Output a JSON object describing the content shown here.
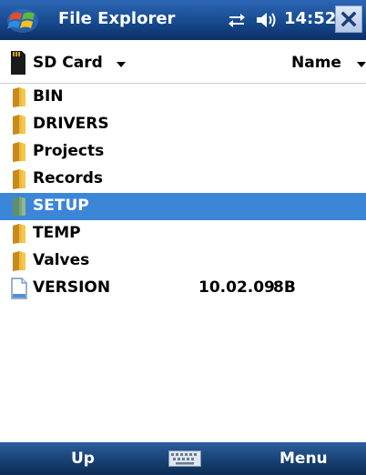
{
  "titlebar": {
    "title": "File Explorer",
    "time": "14:52",
    "start_icon": "windows-flag-icon",
    "connectivity_icon": "connectivity-arrows-icon",
    "volume_icon": "speaker-icon",
    "close_icon": "close-x-icon"
  },
  "header": {
    "location": "SD Card",
    "sort": "Name"
  },
  "files": [
    {
      "name": "BIN",
      "type": "folder",
      "date": "",
      "size": "",
      "selected": false
    },
    {
      "name": "DRIVERS",
      "type": "folder",
      "date": "",
      "size": "",
      "selected": false
    },
    {
      "name": "Projects",
      "type": "folder",
      "date": "",
      "size": "",
      "selected": false
    },
    {
      "name": "Records",
      "type": "folder",
      "date": "",
      "size": "",
      "selected": false
    },
    {
      "name": "SETUP",
      "type": "folder",
      "date": "",
      "size": "",
      "selected": true
    },
    {
      "name": "TEMP",
      "type": "folder",
      "date": "",
      "size": "",
      "selected": false
    },
    {
      "name": "Valves",
      "type": "folder",
      "date": "",
      "size": "",
      "selected": false
    },
    {
      "name": "VERSION",
      "type": "file",
      "date": "10.02.09",
      "size": "8B",
      "selected": false
    }
  ],
  "softkeys": {
    "left": "Up",
    "right": "Menu",
    "center_icon": "keyboard-icon"
  },
  "colors": {
    "titlebar": "#174a8e",
    "selection": "#3c86d8",
    "folder": "#f0b93c"
  }
}
